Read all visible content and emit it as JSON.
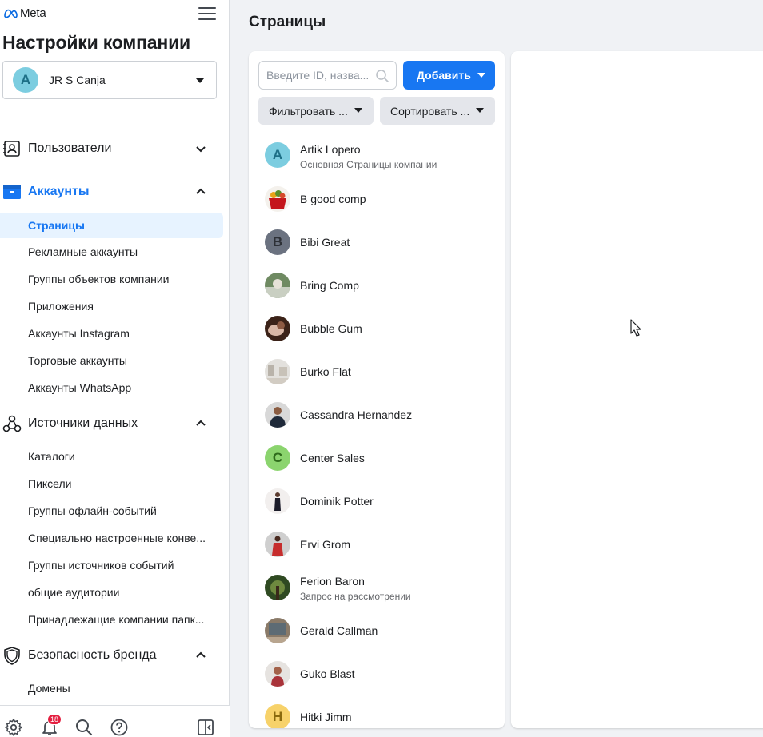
{
  "app": {
    "logo_text": "Meta",
    "title": "Настройки компании"
  },
  "account": {
    "initial": "A",
    "name": "JR S Canja"
  },
  "sidebar": {
    "sections": [
      {
        "label": "Пользователи",
        "icon": "users-icon",
        "expanded": false,
        "items": []
      },
      {
        "label": "Аккаунты",
        "icon": "briefcase-icon",
        "expanded": true,
        "items": [
          {
            "label": "Страницы",
            "selected": true
          },
          {
            "label": "Рекламные аккаунты"
          },
          {
            "label": "Группы объектов компании"
          },
          {
            "label": "Приложения"
          },
          {
            "label": "Аккаунты Instagram"
          },
          {
            "label": "Торговые аккаунты"
          },
          {
            "label": "Аккаунты WhatsApp"
          }
        ]
      },
      {
        "label": "Источники данных",
        "icon": "data-sources-icon",
        "expanded": true,
        "items": [
          {
            "label": "Каталоги"
          },
          {
            "label": "Пиксели"
          },
          {
            "label": "Группы офлайн-событий"
          },
          {
            "label": "Специально настроенные конве..."
          },
          {
            "label": "Группы источников событий"
          },
          {
            "label": "общие аудитории"
          },
          {
            "label": "Принадлежащие компании папк..."
          }
        ]
      },
      {
        "label": "Безопасность бренда",
        "icon": "shield-icon",
        "expanded": true,
        "items": [
          {
            "label": "Домены"
          }
        ]
      }
    ]
  },
  "bottom_bar": {
    "notifications_count": "18"
  },
  "main": {
    "title": "Страницы",
    "search_placeholder": "Введите ID, назва...",
    "add_label": "Добавить",
    "filter_label": "Фильтровать ...",
    "sort_label": "Сортировать ...",
    "pages": [
      {
        "name": "Artik Lopero",
        "sub": "Основная Страницы компании",
        "initial": "A",
        "avatar_bg": "#7ccde0",
        "avatar_fg": "#1d6f86"
      },
      {
        "name": "B good comp",
        "image": "food-basket"
      },
      {
        "name": "Bibi Great",
        "initial": "B",
        "avatar_bg": "#6b7280",
        "avatar_fg": "#2d3036"
      },
      {
        "name": "Bring Comp",
        "image": "green-photo"
      },
      {
        "name": "Bubble Gum",
        "image": "brown-photo"
      },
      {
        "name": "Burko Flat",
        "image": "room-photo"
      },
      {
        "name": "Cassandra Hernandez",
        "image": "man-photo"
      },
      {
        "name": "Center Sales",
        "initial": "C",
        "avatar_bg": "#8bd46e",
        "avatar_fg": "#2f6b1c"
      },
      {
        "name": "Dominik Potter",
        "image": "woman-dress"
      },
      {
        "name": "Ervi Grom",
        "image": "red-dress"
      },
      {
        "name": "Ferion Baron",
        "sub": "Запрос на рассмотрении",
        "image": "forest-photo"
      },
      {
        "name": "Gerald Callman",
        "image": "painting-photo"
      },
      {
        "name": "Guko Blast",
        "image": "woman-portrait"
      },
      {
        "name": "Hitki Jimm",
        "initial": "H",
        "avatar_bg": "#f7d26a",
        "avatar_fg": "#8a6a0e"
      }
    ]
  },
  "colors": {
    "accent": "#1877f2",
    "selected_bg": "#e7f3ff",
    "badge": "#e41e3f"
  }
}
